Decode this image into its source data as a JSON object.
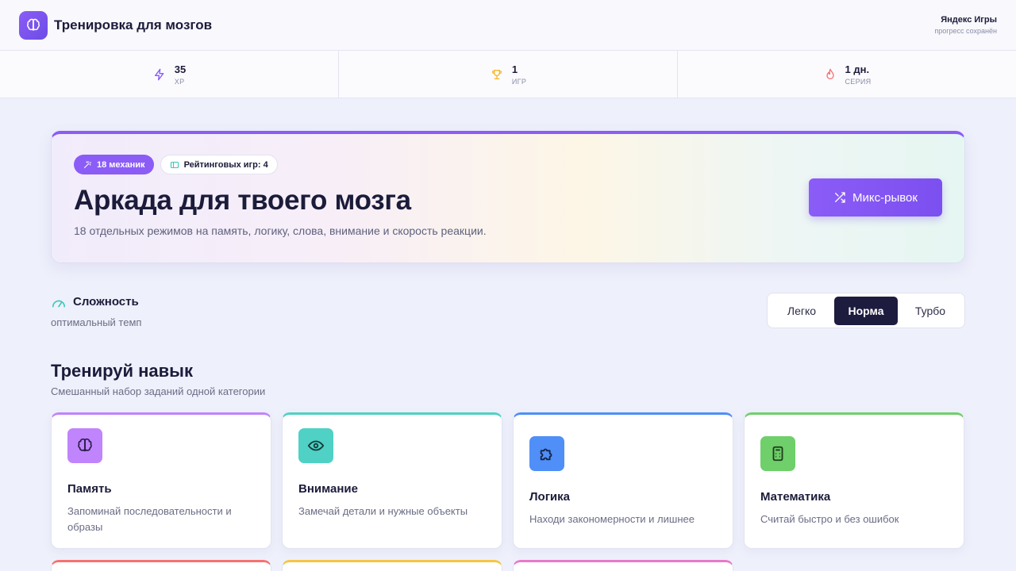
{
  "app": {
    "title": "Тренировка для мозгов",
    "platform": "Яндекс Игры",
    "progress_note": "прогресс сохранён",
    "logo_icon": "brain-icon",
    "accent": "#8b5cf6"
  },
  "stats": [
    {
      "value": "35",
      "label": "XP",
      "icon": "lightning-icon",
      "color": "#8b5cf6"
    },
    {
      "value": "1",
      "label": "ИГР",
      "icon": "trophy-icon",
      "color": "#f5b82e"
    },
    {
      "value": "1 дн.",
      "label": "СЕРИЯ",
      "icon": "flame-icon",
      "color": "#f87171"
    }
  ],
  "hero": {
    "badge_mechanics": "18 механик",
    "badge_ranked": "Рейтинговых игр: 4",
    "title": "Аркада для твоего мозга",
    "subtitle": "18 отдельных режимов на память, логику, слова, внимание и скорость реакции.",
    "mix_button": "Микс-рывок"
  },
  "difficulty": {
    "title": "Сложность",
    "description": "оптимальный темп",
    "options": [
      "Легко",
      "Норма",
      "Турбо"
    ],
    "selected": "Норма"
  },
  "skills": {
    "title": "Тренируй навык",
    "subtitle": "Смешанный набор заданий одной категории",
    "cards": [
      {
        "title": "Память",
        "description": "Запоминай последовательности и образы",
        "icon": "brain-icon",
        "color": "#c084fc"
      },
      {
        "title": "Внимание",
        "description": "Замечай детали и нужные объекты",
        "icon": "eye-icon",
        "color": "#4fd1c5"
      },
      {
        "title": "Логика",
        "description": "Находи закономерности и лишнее",
        "icon": "puzzle-icon",
        "color": "#4f8ff7"
      },
      {
        "title": "Математика",
        "description": "Считай быстро и без ошибок",
        "icon": "calculator-icon",
        "color": "#6fcf6a"
      }
    ]
  }
}
